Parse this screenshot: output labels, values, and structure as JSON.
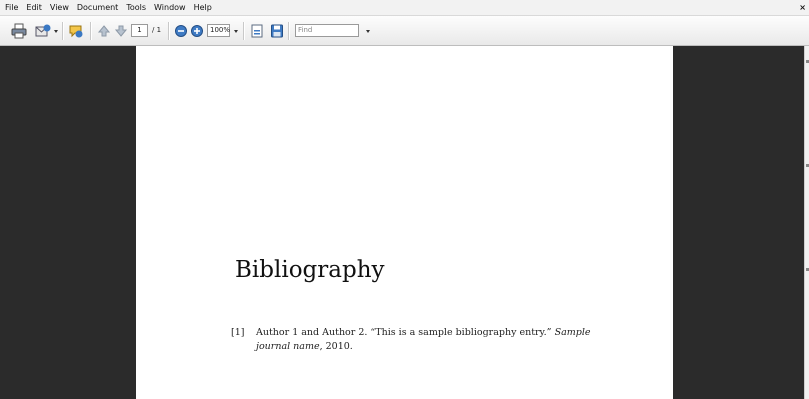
{
  "menu": {
    "items": [
      "File",
      "Edit",
      "View",
      "Document",
      "Tools",
      "Window",
      "Help"
    ],
    "close": "×"
  },
  "toolbar": {
    "page_current": "1",
    "page_total": "/ 1",
    "zoom": "100%",
    "find_placeholder": "Find",
    "icons": [
      "print-icon",
      "email-icon",
      "comment-icon",
      "page-up-icon",
      "page-down-icon",
      "zoom-out-icon",
      "zoom-in-icon",
      "fit-page-icon",
      "save-icon"
    ]
  },
  "document": {
    "heading": "Bibliography",
    "entries": [
      {
        "num": "[1]",
        "text_before": "Author 1 and Author 2. “This is a sample bibliography entry.”",
        "italic_1": "Sample journal name",
        "text_after": ", 2010."
      }
    ]
  }
}
